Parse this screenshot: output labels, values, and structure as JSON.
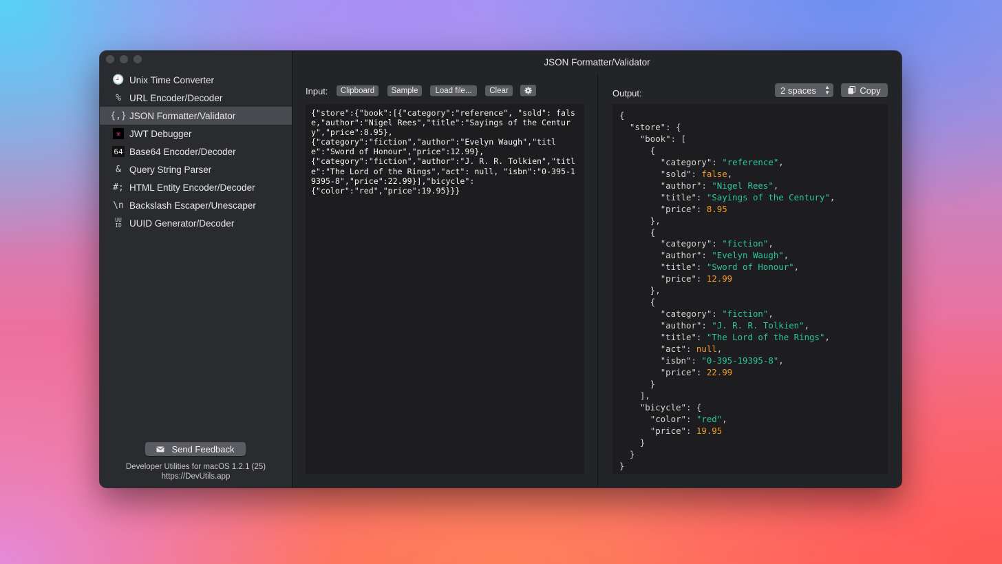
{
  "window": {
    "title": "JSON Formatter/Validator"
  },
  "sidebar": {
    "items": [
      {
        "icon": "clock-icon",
        "glyph": "🕘",
        "label": "Unix Time Converter"
      },
      {
        "icon": "percent-icon",
        "glyph": "%",
        "label": "URL Encoder/Decoder"
      },
      {
        "icon": "braces-icon",
        "glyph": "{,}",
        "label": "JSON Formatter/Validator",
        "active": true
      },
      {
        "icon": "jwt-logo-icon",
        "glyph": "✳",
        "label": "JWT Debugger"
      },
      {
        "icon": "base64-icon",
        "glyph": "64",
        "label": "Base64 Encoder/Decoder"
      },
      {
        "icon": "ampersand-icon",
        "glyph": "&",
        "label": "Query String Parser"
      },
      {
        "icon": "html-entity-icon",
        "glyph": "#;",
        "label": "HTML Entity Encoder/Decoder"
      },
      {
        "icon": "backslash-icon",
        "glyph": "\\n",
        "label": "Backslash Escaper/Unescaper"
      },
      {
        "icon": "uuid-icon",
        "glyph": "UU ID",
        "label": "UUID Generator/Decoder"
      }
    ],
    "feedback_label": "Send Feedback",
    "footer_line1": "Developer Utilities for macOS 1.2.1 (25)",
    "footer_line2": "https://DevUtils.app"
  },
  "input": {
    "label": "Input:",
    "buttons": {
      "clipboard": "Clipboard",
      "sample": "Sample",
      "load": "Load file...",
      "clear": "Clear"
    },
    "text": "{\"store\":{\"book\":[{\"category\":\"reference\", \"sold\": false,\"author\":\"Nigel Rees\",\"title\":\"Sayings of the Century\",\"price\":8.95},\n{\"category\":\"fiction\",\"author\":\"Evelyn Waugh\",\"title\":\"Sword of Honour\",\"price\":12.99},\n{\"category\":\"fiction\",\"author\":\"J. R. R. Tolkien\",\"title\":\"The Lord of the Rings\",\"act\": null, \"isbn\":\"0-395-19395-8\",\"price\":22.99}],\"bicycle\":\n{\"color\":\"red\",\"price\":19.95}}}"
  },
  "output": {
    "label": "Output:",
    "indent_option": "2 spaces",
    "copy_label": "Copy",
    "lines": [
      [
        [
          "p",
          "{"
        ]
      ],
      [
        [
          "p",
          "  "
        ],
        [
          "k",
          "\"store\""
        ],
        [
          "p",
          ": {"
        ]
      ],
      [
        [
          "p",
          "    "
        ],
        [
          "k",
          "\"book\""
        ],
        [
          "p",
          ": ["
        ]
      ],
      [
        [
          "p",
          "      {"
        ]
      ],
      [
        [
          "p",
          "        "
        ],
        [
          "k",
          "\"category\""
        ],
        [
          "p",
          ": "
        ],
        [
          "s",
          "\"reference\""
        ],
        [
          "p",
          ","
        ]
      ],
      [
        [
          "p",
          "        "
        ],
        [
          "k",
          "\"sold\""
        ],
        [
          "p",
          ": "
        ],
        [
          "b",
          "false"
        ],
        [
          "p",
          ","
        ]
      ],
      [
        [
          "p",
          "        "
        ],
        [
          "k",
          "\"author\""
        ],
        [
          "p",
          ": "
        ],
        [
          "s",
          "\"Nigel Rees\""
        ],
        [
          "p",
          ","
        ]
      ],
      [
        [
          "p",
          "        "
        ],
        [
          "k",
          "\"title\""
        ],
        [
          "p",
          ": "
        ],
        [
          "s",
          "\"Sayings of the Century\""
        ],
        [
          "p",
          ","
        ]
      ],
      [
        [
          "p",
          "        "
        ],
        [
          "k",
          "\"price\""
        ],
        [
          "p",
          ": "
        ],
        [
          "n",
          "8.95"
        ]
      ],
      [
        [
          "p",
          "      },"
        ]
      ],
      [
        [
          "p",
          "      {"
        ]
      ],
      [
        [
          "p",
          "        "
        ],
        [
          "k",
          "\"category\""
        ],
        [
          "p",
          ": "
        ],
        [
          "s",
          "\"fiction\""
        ],
        [
          "p",
          ","
        ]
      ],
      [
        [
          "p",
          "        "
        ],
        [
          "k",
          "\"author\""
        ],
        [
          "p",
          ": "
        ],
        [
          "s",
          "\"Evelyn Waugh\""
        ],
        [
          "p",
          ","
        ]
      ],
      [
        [
          "p",
          "        "
        ],
        [
          "k",
          "\"title\""
        ],
        [
          "p",
          ": "
        ],
        [
          "s",
          "\"Sword of Honour\""
        ],
        [
          "p",
          ","
        ]
      ],
      [
        [
          "p",
          "        "
        ],
        [
          "k",
          "\"price\""
        ],
        [
          "p",
          ": "
        ],
        [
          "n",
          "12.99"
        ]
      ],
      [
        [
          "p",
          "      },"
        ]
      ],
      [
        [
          "p",
          "      {"
        ]
      ],
      [
        [
          "p",
          "        "
        ],
        [
          "k",
          "\"category\""
        ],
        [
          "p",
          ": "
        ],
        [
          "s",
          "\"fiction\""
        ],
        [
          "p",
          ","
        ]
      ],
      [
        [
          "p",
          "        "
        ],
        [
          "k",
          "\"author\""
        ],
        [
          "p",
          ": "
        ],
        [
          "s",
          "\"J. R. R. Tolkien\""
        ],
        [
          "p",
          ","
        ]
      ],
      [
        [
          "p",
          "        "
        ],
        [
          "k",
          "\"title\""
        ],
        [
          "p",
          ": "
        ],
        [
          "s",
          "\"The Lord of the Rings\""
        ],
        [
          "p",
          ","
        ]
      ],
      [
        [
          "p",
          "        "
        ],
        [
          "k",
          "\"act\""
        ],
        [
          "p",
          ": "
        ],
        [
          "b",
          "null"
        ],
        [
          "p",
          ","
        ]
      ],
      [
        [
          "p",
          "        "
        ],
        [
          "k",
          "\"isbn\""
        ],
        [
          "p",
          ": "
        ],
        [
          "s",
          "\"0-395-19395-8\""
        ],
        [
          "p",
          ","
        ]
      ],
      [
        [
          "p",
          "        "
        ],
        [
          "k",
          "\"price\""
        ],
        [
          "p",
          ": "
        ],
        [
          "n",
          "22.99"
        ]
      ],
      [
        [
          "p",
          "      }"
        ]
      ],
      [
        [
          "p",
          "    ],"
        ]
      ],
      [
        [
          "p",
          "    "
        ],
        [
          "k",
          "\"bicycle\""
        ],
        [
          "p",
          ": {"
        ]
      ],
      [
        [
          "p",
          "      "
        ],
        [
          "k",
          "\"color\""
        ],
        [
          "p",
          ": "
        ],
        [
          "s",
          "\"red\""
        ],
        [
          "p",
          ","
        ]
      ],
      [
        [
          "p",
          "      "
        ],
        [
          "k",
          "\"price\""
        ],
        [
          "p",
          ": "
        ],
        [
          "n",
          "19.95"
        ]
      ],
      [
        [
          "p",
          "    }"
        ]
      ],
      [
        [
          "p",
          "  }"
        ]
      ],
      [
        [
          "p",
          "}"
        ]
      ]
    ]
  },
  "colors": {
    "string": "#2fc3a0",
    "number": "#f49a2a",
    "key": "#d6d6d6",
    "sidebar_active": "#4a4b50"
  }
}
